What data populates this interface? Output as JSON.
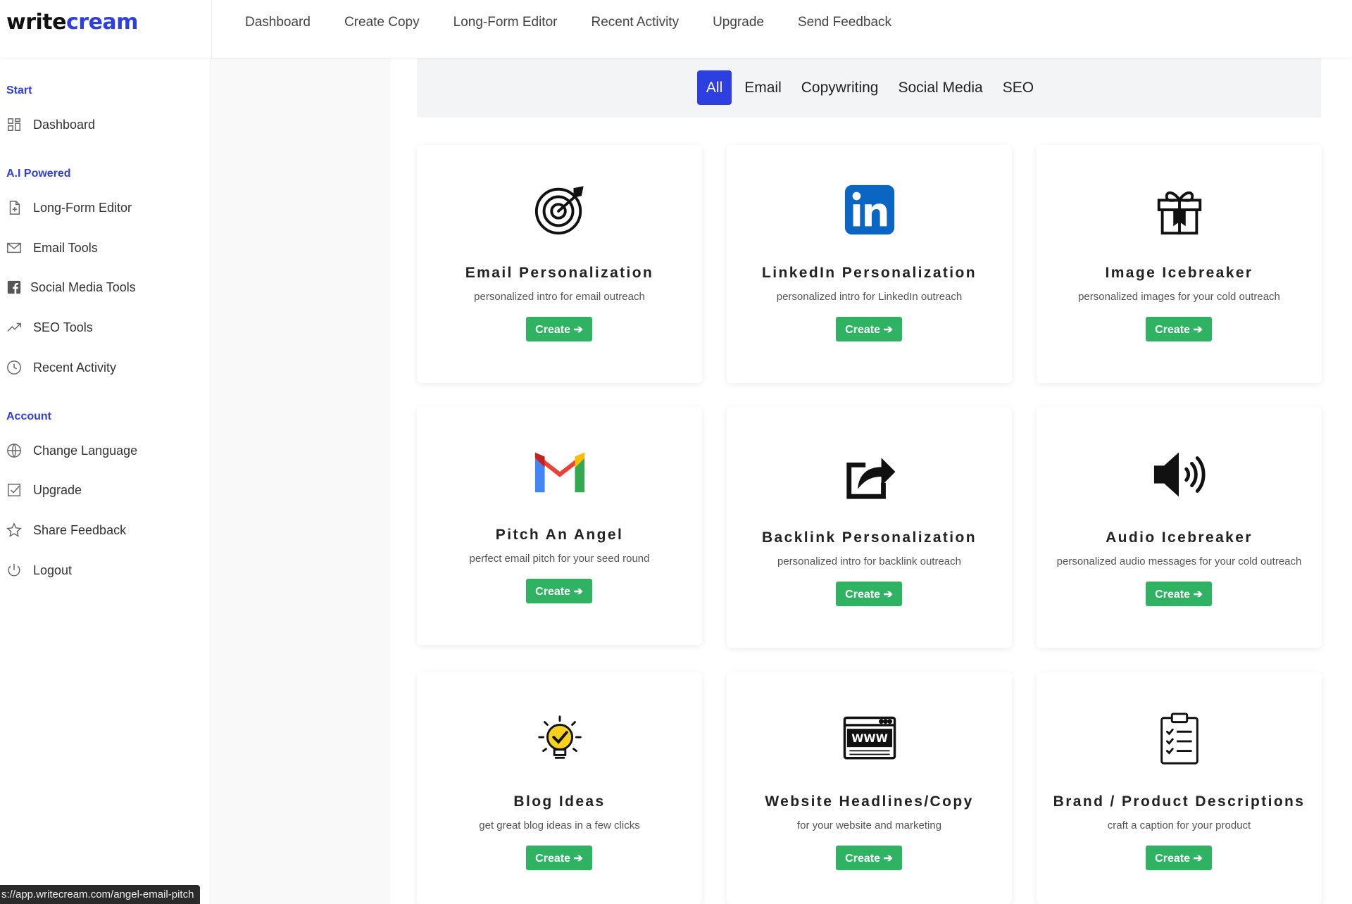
{
  "app": {
    "logo_part1": "write",
    "logo_part2": "cream",
    "accent_color": "#2d3fe0",
    "create_button_color": "#2fb362"
  },
  "topnav": [
    "Dashboard",
    "Create Copy",
    "Long-Form Editor",
    "Recent Activity",
    "Upgrade",
    "Send Feedback"
  ],
  "sidebar": {
    "start_label": "Start",
    "start_items": [
      {
        "label": "Dashboard",
        "icon": "grid-icon"
      }
    ],
    "ai_label": "A.I Powered",
    "ai_items": [
      {
        "label": "Long-Form Editor",
        "icon": "document-plus-icon"
      },
      {
        "label": "Email Tools",
        "icon": "envelope-icon"
      },
      {
        "label": "Social Media Tools",
        "icon": "facebook-icon"
      },
      {
        "label": "SEO Tools",
        "icon": "trend-up-icon"
      },
      {
        "label": "Recent Activity",
        "icon": "clock-icon"
      }
    ],
    "account_label": "Account",
    "account_items": [
      {
        "label": "Change Language",
        "icon": "globe-icon"
      },
      {
        "label": "Upgrade",
        "icon": "checkbox-icon"
      },
      {
        "label": "Share Feedback",
        "icon": "star-icon"
      },
      {
        "label": "Logout",
        "icon": "power-icon"
      }
    ]
  },
  "filters": {
    "tabs": [
      "All",
      "Email",
      "Copywriting",
      "Social Media",
      "SEO"
    ],
    "active": "All"
  },
  "cards": [
    {
      "title": "Email Personalization",
      "desc": "personalized intro for email outreach",
      "button": "Create ➔",
      "icon": "target-icon"
    },
    {
      "title": "LinkedIn Personalization",
      "desc": "personalized intro for LinkedIn outreach",
      "button": "Create ➔",
      "icon": "linkedin-icon"
    },
    {
      "title": "Image Icebreaker",
      "desc": "personalized images for your cold outreach",
      "button": "Create ➔",
      "icon": "gift-icon"
    },
    {
      "title": "Pitch An Angel",
      "desc": "perfect email pitch for your seed round",
      "button": "Create ➔",
      "icon": "gmail-icon"
    },
    {
      "title": "Backlink Personalization",
      "desc": "personalized intro for backlink outreach",
      "button": "Create ➔",
      "icon": "share-icon"
    },
    {
      "title": "Audio Icebreaker",
      "desc": "personalized audio messages for your cold outreach",
      "button": "Create ➔",
      "icon": "speaker-icon"
    },
    {
      "title": "Blog Ideas",
      "desc": "get great blog ideas in a few clicks",
      "button": "Create ➔",
      "icon": "lightbulb-icon"
    },
    {
      "title": "Website Headlines/Copy",
      "desc": "for your website and marketing",
      "button": "Create ➔",
      "icon": "www-icon"
    },
    {
      "title": "Brand / Product Descriptions",
      "desc": "craft a caption for your product",
      "button": "Create ➔",
      "icon": "clipboard-icon"
    }
  ],
  "status_url": "s://app.writecream.com/angel-email-pitch"
}
